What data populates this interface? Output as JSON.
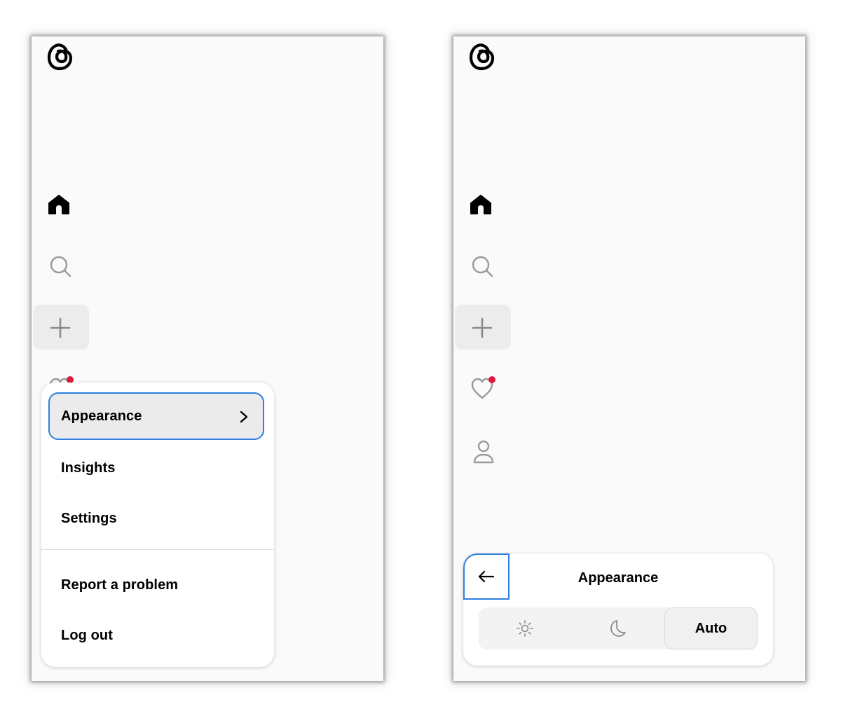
{
  "left_screen": {
    "menu": {
      "items": [
        {
          "label": "Appearance"
        },
        {
          "label": "Insights"
        },
        {
          "label": "Settings"
        },
        {
          "label": "Report a problem"
        },
        {
          "label": "Log out"
        }
      ]
    }
  },
  "right_screen": {
    "appearance": {
      "title": "Appearance",
      "modes": {
        "light": "sun-icon",
        "dark": "moon-icon",
        "auto_label": "Auto"
      }
    }
  },
  "nav_icons": [
    "threads-logo-icon",
    "home-icon",
    "search-icon",
    "plus-icon",
    "heart-icon",
    "profile-icon"
  ],
  "colors": {
    "highlight": "#2f7fe0",
    "notification_dot": "#e0193b",
    "background": "#fafafa"
  }
}
